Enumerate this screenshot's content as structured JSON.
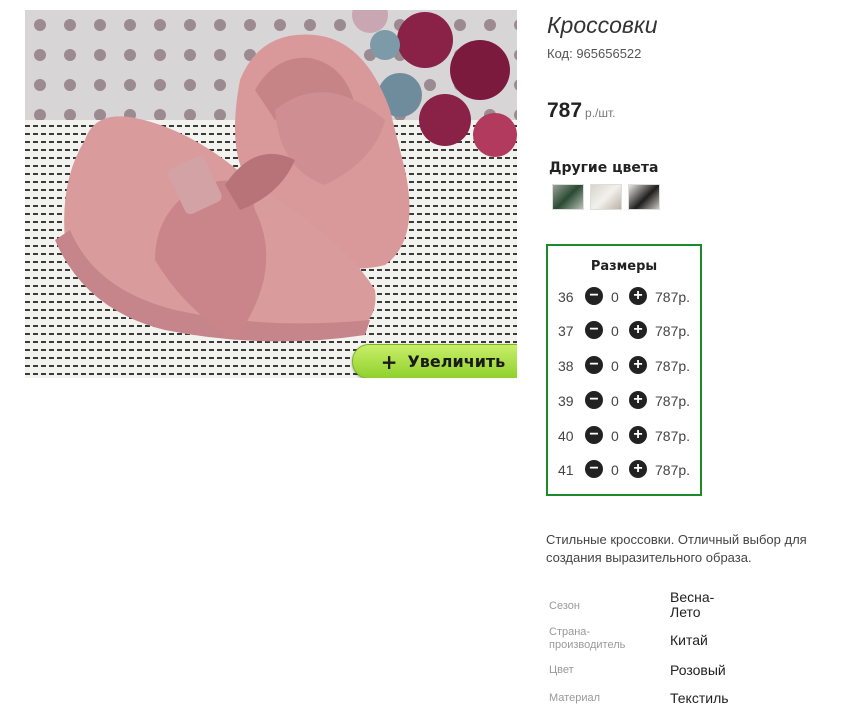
{
  "product": {
    "title": "Кроссовки",
    "code": "Код: 965656522",
    "price": "787",
    "price_unit": "р./шт.",
    "zoom_label": "Увеличить",
    "zoom_plus": "+"
  },
  "colors": {
    "heading": "Другие цвета",
    "swatches": [
      "green-variant",
      "white-variant",
      "black-variant"
    ]
  },
  "sizes": {
    "heading": "Размеры",
    "minus": "−",
    "plus": "+",
    "rows": [
      {
        "size": "36",
        "qty": "0",
        "price": "787р."
      },
      {
        "size": "37",
        "qty": "0",
        "price": "787р."
      },
      {
        "size": "38",
        "qty": "0",
        "price": "787р."
      },
      {
        "size": "39",
        "qty": "0",
        "price": "787р."
      },
      {
        "size": "40",
        "qty": "0",
        "price": "787р."
      },
      {
        "size": "41",
        "qty": "0",
        "price": "787р."
      }
    ]
  },
  "description": "Стильные кроссовки. Отличный выбор для создания выразительного образа.",
  "specs": [
    {
      "label": "Сезон",
      "value": "Весна-Лето"
    },
    {
      "label": "Страна-производитель",
      "value": "Китай"
    },
    {
      "label": "Цвет",
      "value": "Розовый"
    },
    {
      "label": "Материал",
      "value": "Текстиль"
    }
  ],
  "theme": {
    "accent_green": "#1d8a2c",
    "button_green": "#a6dc3c"
  }
}
